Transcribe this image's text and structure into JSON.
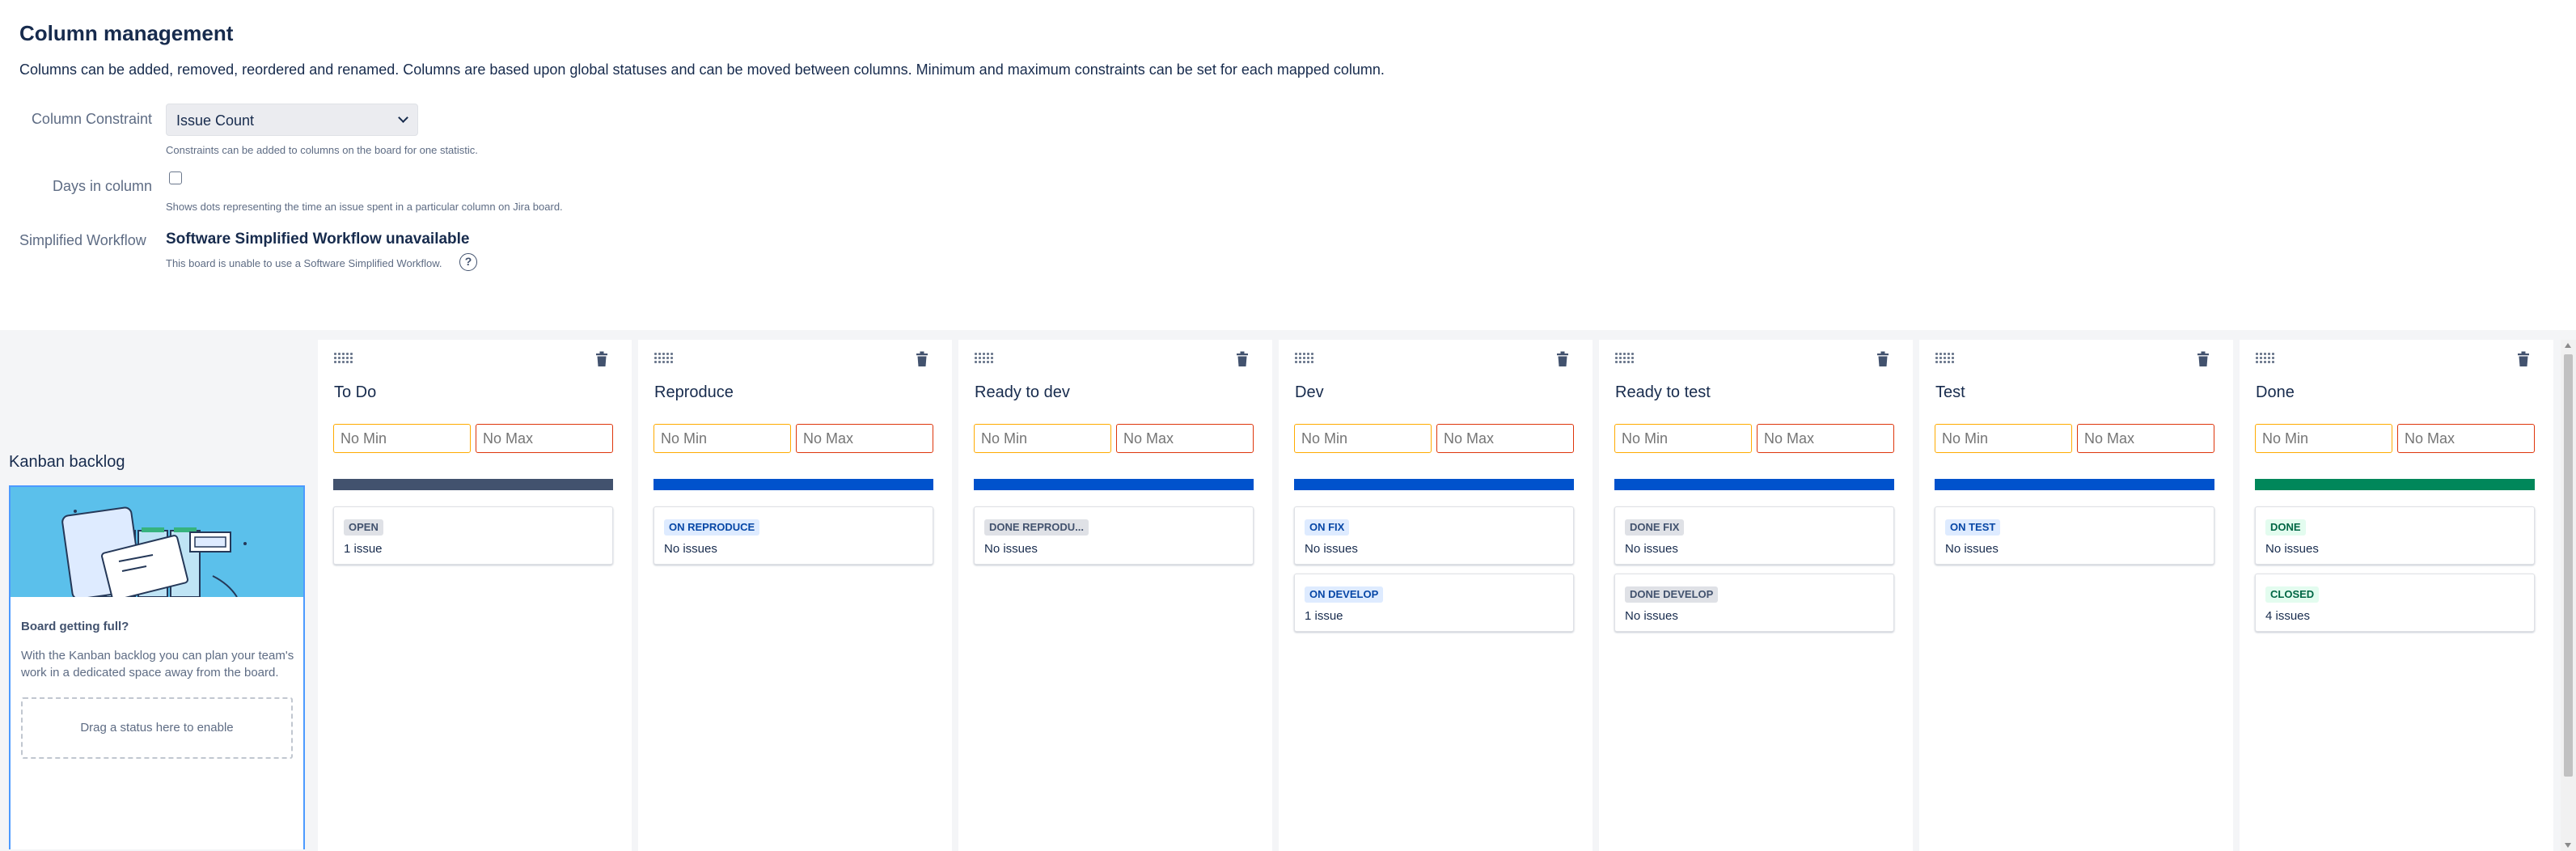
{
  "page": {
    "title": "Column management",
    "description": "Columns can be added, removed, reordered and renamed. Columns are based upon global statuses and can be moved between columns. Minimum and maximum constraints can be set for each mapped column."
  },
  "settings": {
    "column_constraint": {
      "label": "Column Constraint",
      "value": "Issue Count",
      "hint": "Constraints can be added to columns on the board for one statistic."
    },
    "days_in_column": {
      "label": "Days in column",
      "checked": false,
      "hint": "Shows dots representing the time an issue spent in a particular column on Jira board."
    },
    "simplified_workflow": {
      "label": "Simplified Workflow",
      "title": "Software Simplified Workflow unavailable",
      "hint": "This board is unable to use a Software Simplified Workflow.",
      "help_icon": "?"
    }
  },
  "backlog": {
    "title": "Kanban backlog",
    "heading": "Board getting full?",
    "text": "With the Kanban backlog you can plan your team's work in a dedicated space away from the board.",
    "dropzone": "Drag a status here to enable"
  },
  "columns": [
    {
      "name": "To Do",
      "min_placeholder": "No Min",
      "max_placeholder": "No Max",
      "color": "#42526e",
      "statuses": [
        {
          "label": "OPEN",
          "style": "grey",
          "count": "1 issue"
        }
      ]
    },
    {
      "name": "Reproduce",
      "min_placeholder": "No Min",
      "max_placeholder": "No Max",
      "color": "#0052cc",
      "statuses": [
        {
          "label": "ON REPRODUCE",
          "style": "blue",
          "count": "No issues"
        }
      ]
    },
    {
      "name": "Ready to dev",
      "min_placeholder": "No Min",
      "max_placeholder": "No Max",
      "color": "#0052cc",
      "statuses": [
        {
          "label": "DONE REPRODU...",
          "style": "grey",
          "count": "No issues"
        }
      ]
    },
    {
      "name": "Dev",
      "min_placeholder": "No Min",
      "max_placeholder": "No Max",
      "color": "#0052cc",
      "statuses": [
        {
          "label": "ON FIX",
          "style": "blue",
          "count": "No issues"
        },
        {
          "label": "ON DEVELOP",
          "style": "blue",
          "count": "1 issue"
        }
      ]
    },
    {
      "name": "Ready to test",
      "min_placeholder": "No Min",
      "max_placeholder": "No Max",
      "color": "#0052cc",
      "statuses": [
        {
          "label": "DONE FIX",
          "style": "grey",
          "count": "No issues"
        },
        {
          "label": "DONE DEVELOP",
          "style": "grey",
          "count": "No issues"
        }
      ]
    },
    {
      "name": "Test",
      "min_placeholder": "No Min",
      "max_placeholder": "No Max",
      "color": "#0052cc",
      "statuses": [
        {
          "label": "ON TEST",
          "style": "blue",
          "count": "No issues"
        }
      ]
    },
    {
      "name": "Done",
      "min_placeholder": "No Min",
      "max_placeholder": "No Max",
      "color": "#00875a",
      "statuses": [
        {
          "label": "DONE",
          "style": "green",
          "count": "No issues"
        },
        {
          "label": "CLOSED",
          "style": "green",
          "count": "4 issues"
        }
      ]
    }
  ]
}
